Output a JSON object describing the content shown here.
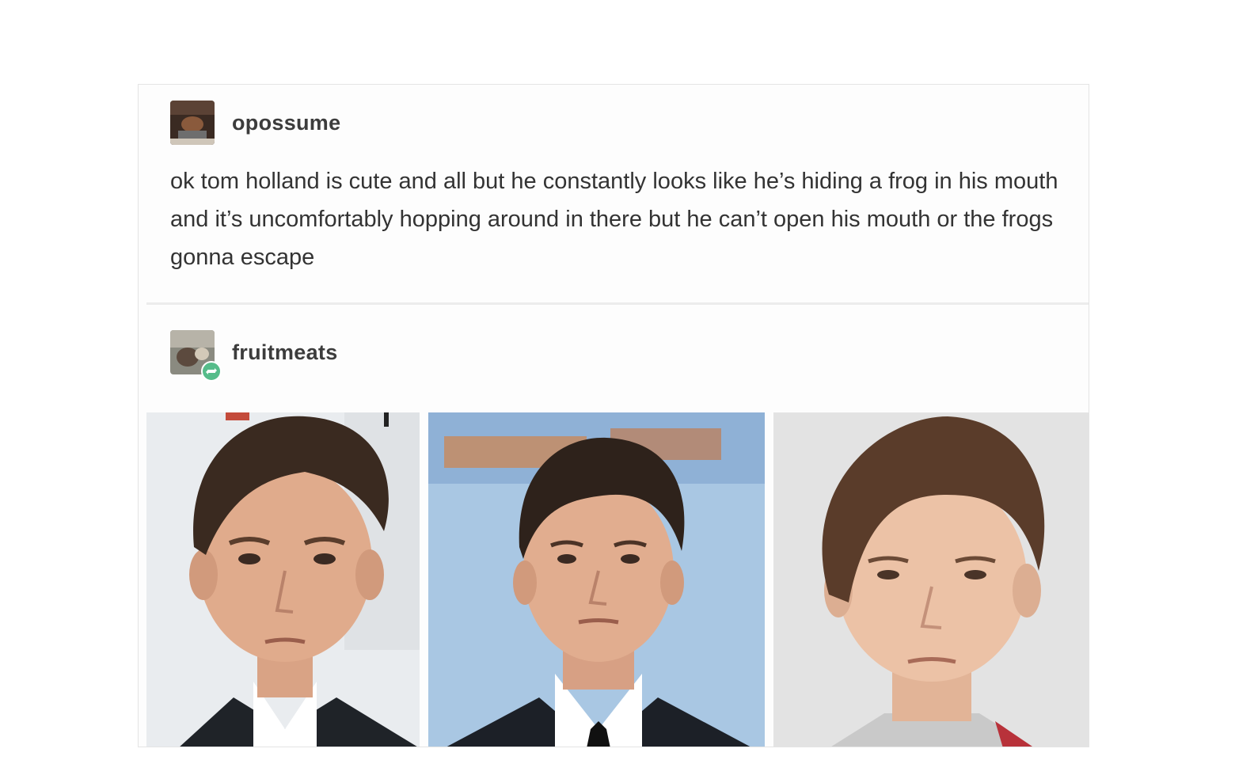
{
  "posts": [
    {
      "username": "opossume",
      "avatar_icon": "user-avatar-icon",
      "text": "ok tom holland is cute and all but he constantly looks like he’s hiding a frog in his mouth and it’s uncomfortably hopping around in there but he can’t open his mouth or the frogs gonna escape"
    },
    {
      "username": "fruitmeats",
      "avatar_icon": "user-avatar-icon",
      "badge_icon": "reblog-icon",
      "photos": [
        {
          "alt": "portrait photo 1"
        },
        {
          "alt": "portrait photo 2"
        },
        {
          "alt": "portrait photo 3"
        }
      ]
    }
  ],
  "colors": {
    "reblog_badge": "#56bc8a",
    "username_text": "#3c3c3c",
    "body_text": "#333333"
  }
}
